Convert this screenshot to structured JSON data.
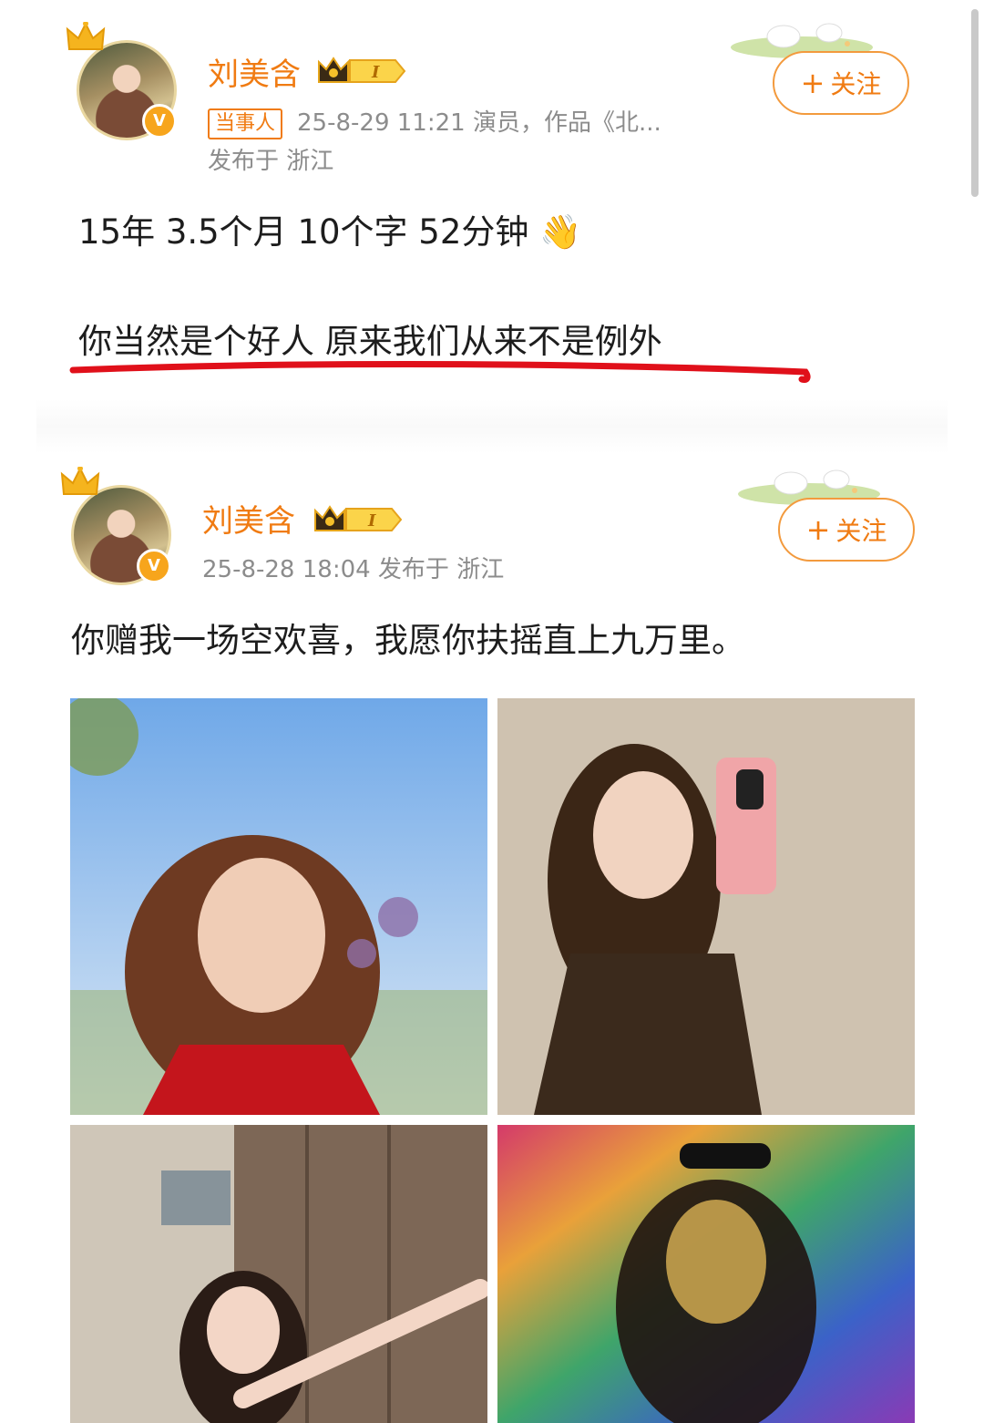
{
  "colors": {
    "accent": "#f07b12",
    "meta": "#8c8c8c",
    "underline": "#e0101a"
  },
  "posts": [
    {
      "username": "刘美含",
      "vip_level": "I",
      "tag": "当事人",
      "meta": "25-8-29 11:21  演员，作品《北...",
      "location": "发布于 浙江",
      "follow_label": "关注",
      "lines": [
        "15年 3.5个月 10个字 52分钟 👋",
        "你当然是个好人   原来我们从来不是例外"
      ]
    },
    {
      "username": "刘美含",
      "vip_level": "I",
      "meta": "25-8-28 18:04  发布于 浙江",
      "follow_label": "关注",
      "text": "你赠我一场空欢喜，我愿你扶摇直上九万里。",
      "images": [
        {
          "icon": "photo-sky-portrait"
        },
        {
          "icon": "photo-mirror-selfie"
        },
        {
          "icon": "photo-door-pose"
        },
        {
          "icon": "photo-rainbow-light"
        }
      ]
    }
  ],
  "icons": [
    "crown-icon",
    "verified-v-icon",
    "vip-crown-badge-icon",
    "plus-icon",
    "decor-sheep-icon"
  ]
}
